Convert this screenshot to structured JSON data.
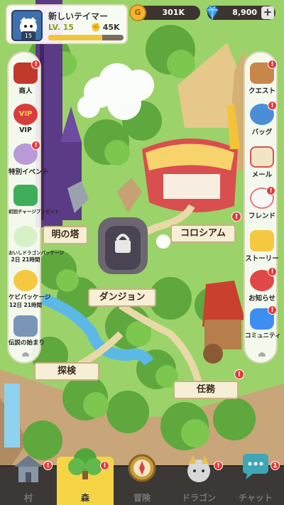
{
  "player": {
    "name": "新しいテイマー",
    "level": "LV. 15",
    "avatar_level": "15",
    "power": "45K",
    "xp_progress": 0.72
  },
  "currency": {
    "gold_icon": "G",
    "gold": "301K",
    "gems": "8,900",
    "plus": "+"
  },
  "left_menu": [
    {
      "label": "商人",
      "icon": "merchant-icon",
      "badge": "!"
    },
    {
      "label": "VIP",
      "icon": "vip-icon",
      "badge": ""
    },
    {
      "label": "特別イベント",
      "icon": "event-icon",
      "badge": "!"
    },
    {
      "label": "初回チャージプレゼント",
      "icon": "first-charge-icon",
      "badge": ""
    },
    {
      "label": "おいしドラゴンパッケージ",
      "sub": "2日 21時間",
      "icon": "dragon-package-icon",
      "badge": ""
    },
    {
      "label": "ケビパッケージ",
      "sub": "12日 21時間",
      "icon": "kebi-package-icon",
      "badge": ""
    },
    {
      "label": "伝説の始まり",
      "icon": "legend-icon",
      "badge": ""
    }
  ],
  "right_menu": [
    {
      "label": "クエスト",
      "icon": "quest-icon",
      "badge": "!"
    },
    {
      "label": "バッグ",
      "icon": "bag-icon",
      "badge": "!"
    },
    {
      "label": "メール",
      "icon": "mail-icon",
      "badge": ""
    },
    {
      "label": "フレンド",
      "icon": "friend-icon",
      "badge": "!"
    },
    {
      "label": "ストーリー",
      "icon": "story-icon",
      "badge": ""
    },
    {
      "label": "お知らせ",
      "icon": "notice-icon",
      "badge": "!"
    },
    {
      "label": "コミュニティ",
      "icon": "community-icon",
      "badge": "!"
    }
  ],
  "map": {
    "tower": "明の塔",
    "colosseum": "コロシアム",
    "dungeon": "ダンジョン",
    "explore": "探検",
    "mission": "任務",
    "badge": "!"
  },
  "bottom_nav": [
    {
      "label": "村",
      "icon": "village-icon",
      "badge": "!",
      "active": false
    },
    {
      "label": "森",
      "icon": "forest-icon",
      "badge": "!",
      "active": true
    },
    {
      "label": "冒険",
      "icon": "compass-icon",
      "badge": "",
      "active": false
    },
    {
      "label": "ドラゴン",
      "icon": "dragon-icon",
      "badge": "!",
      "active": false
    },
    {
      "label": "チャット",
      "icon": "chat-icon",
      "badge": "1",
      "active": false
    }
  ],
  "colors": {
    "accent": "#f5d545",
    "badge": "#e23b3b",
    "nav_bg": "#3b3835"
  }
}
